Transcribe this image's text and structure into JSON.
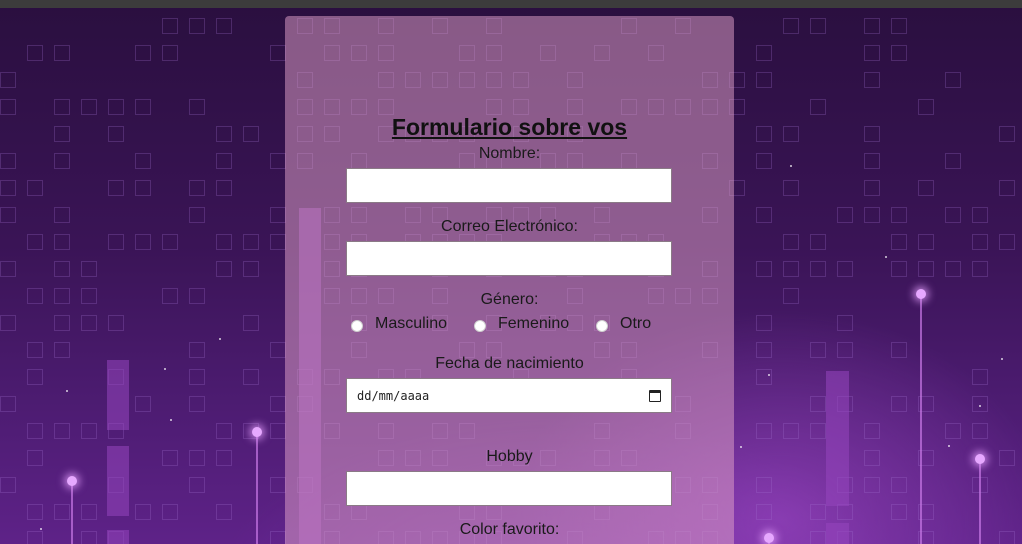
{
  "form": {
    "title": "Formulario sobre vos",
    "fields": {
      "nombre": {
        "label": "Nombre:",
        "value": ""
      },
      "correo": {
        "label": "Correo Electrónico:",
        "value": ""
      },
      "genero": {
        "label": "Género:",
        "options": [
          "Masculino",
          "Femenino",
          "Otro"
        ]
      },
      "fecha": {
        "label": "Fecha de nacimiento",
        "placeholder": "dd/mm/aaaa"
      },
      "hobby": {
        "label": "Hobby",
        "value": ""
      },
      "color": {
        "label": "Color favorito:"
      }
    }
  },
  "icons": {
    "calendar": "calendar-icon"
  },
  "colors": {
    "background_dark": "#2a0f3f",
    "background_glow": "#a050d2",
    "card": "#dea0c8"
  }
}
